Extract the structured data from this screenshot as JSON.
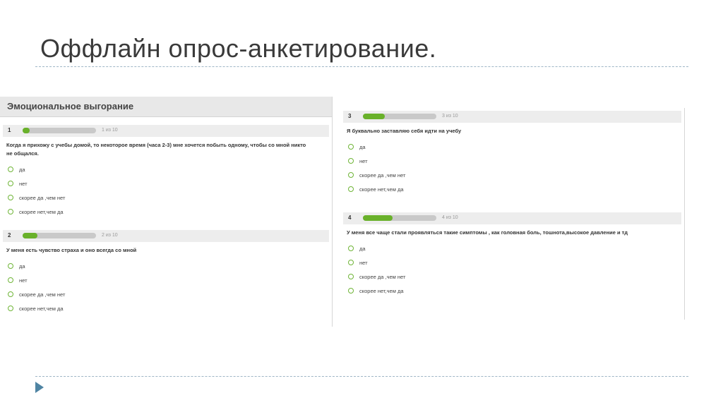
{
  "slide": {
    "title": "Оффлайн опрос-анкетирование."
  },
  "colors": {
    "accent_green": "#69b12a",
    "nav_arrow": "#4f84a3"
  },
  "survey_left": {
    "header": "Эмоциональное выгорание",
    "questions": [
      {
        "number": "1",
        "count": "1 из 10",
        "progress": 0.1,
        "text": "Когда я прихожу с учебы домой, то некоторое время (часа 2-3) мне хочется побыть одному, чтобы со мной никто не общался.",
        "options": [
          "да",
          "нет",
          "скорее да ,чем нет",
          "скорее нет,чем да"
        ]
      },
      {
        "number": "2",
        "count": "2 из 10",
        "progress": 0.2,
        "text": "У меня есть чувство страха и оно всегда со мной",
        "options": [
          "да",
          "нет",
          "скорее да ,чем нет",
          "скорее нет,чем да"
        ]
      }
    ]
  },
  "survey_right": {
    "questions": [
      {
        "number": "3",
        "count": "3 из 10",
        "progress": 0.3,
        "text": "Я буквально заставляю себя идти на учебу",
        "options": [
          "да",
          "нет",
          "скорее да ,чем нет",
          "скорее нет,чем да"
        ]
      },
      {
        "number": "4",
        "count": "4 из 10",
        "progress": 0.4,
        "text": "У меня все чаще стали проявляться такие симптомы , как головная боль, тошнота,высокое давление и тд",
        "options": [
          "да",
          "нет",
          "скорее да ,чем нет",
          "скорее нет,чем да"
        ]
      }
    ]
  }
}
